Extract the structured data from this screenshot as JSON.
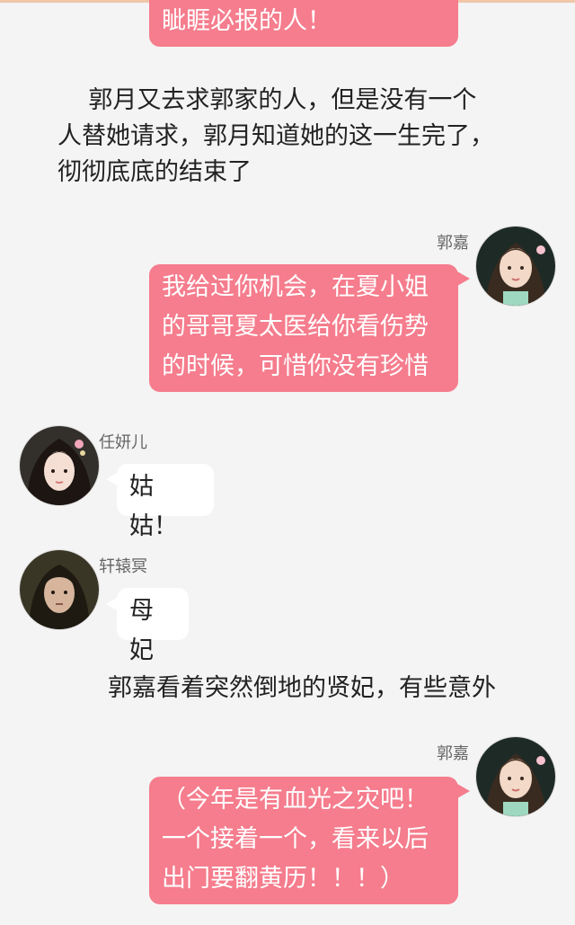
{
  "messages": {
    "m0": {
      "text": "眦睚必报的人！"
    },
    "narration1": {
      "text": "    郭月又去求郭家的人，但是没有一个\n人替她请求，郭月知道她的这一生完了，\n彻彻底底的结束了"
    },
    "m1": {
      "speaker": "郭嘉",
      "text": "我给过你机会，在夏小姐\n的哥哥夏太医给你看伤势\n的时候，可惜你没有珍惜"
    },
    "m2": {
      "speaker": "任妍儿",
      "text": "姑姑！"
    },
    "m3": {
      "speaker": "轩辕冥",
      "text": "母妃"
    },
    "narration2": {
      "text": "郭嘉看着突然倒地的贤妃，有些意外"
    },
    "m4": {
      "speaker": "郭嘉",
      "text": "（今年是有血光之灾吧！\n一个接着一个，看来以后\n出门要翻黄历！！！）"
    }
  },
  "colors": {
    "pink_bubble": "#f57d8d",
    "white_bubble": "#ffffff",
    "background": "#f4f4f4"
  },
  "icons": {
    "avatar_guojia": "female-portrait-light-hair",
    "avatar_renyaner": "female-portrait-dark-hair",
    "avatar_xuanyuanming": "male-portrait-long-hair"
  }
}
